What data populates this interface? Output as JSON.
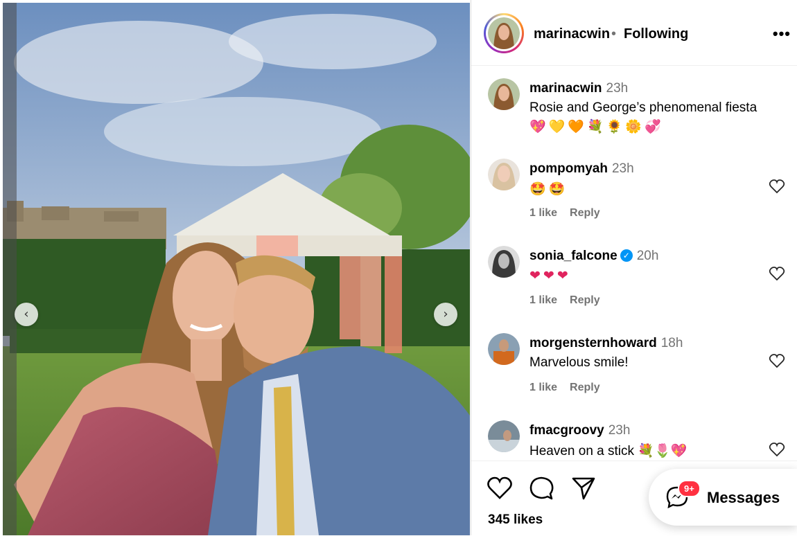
{
  "post": {
    "username": "marinacwin",
    "separator": "•",
    "follow_status": "Following",
    "more_label": "•••",
    "caption_time": "23h",
    "caption_text": "Rosie and George’s phenomenal fiesta",
    "caption_emojis": "💖💛🧡💐🌻🌼💞",
    "likes": "345 likes"
  },
  "comments": [
    {
      "username": "pompomyah",
      "time": "23h",
      "text": "🤩🤩",
      "likes": "1 like",
      "reply": "Reply",
      "verified": false
    },
    {
      "username": "sonia_falcone",
      "time": "20h",
      "text": "❤❤❤",
      "likes": "1 like",
      "reply": "Reply",
      "verified": true
    },
    {
      "username": "morgensternhoward",
      "time": "18h",
      "text": "Marvelous smile!",
      "likes": "1 like",
      "reply": "Reply",
      "verified": false
    },
    {
      "username": "fmacgroovy",
      "time": "23h",
      "text": "Heaven on a stick 💐🌷💖",
      "likes": "",
      "reply": "",
      "verified": false
    }
  ],
  "messages": {
    "label": "Messages",
    "badge": "9+"
  },
  "carousel": {
    "prev": "‹",
    "next": "›"
  },
  "icons": {
    "like": "heart-icon",
    "comment": "comment-icon",
    "share": "send-icon",
    "messages": "messenger-icon",
    "verified": "verified-badge-icon"
  },
  "colors": {
    "story_ring": "#d62976",
    "verified": "#0095f6",
    "badge": "#ff3040"
  }
}
